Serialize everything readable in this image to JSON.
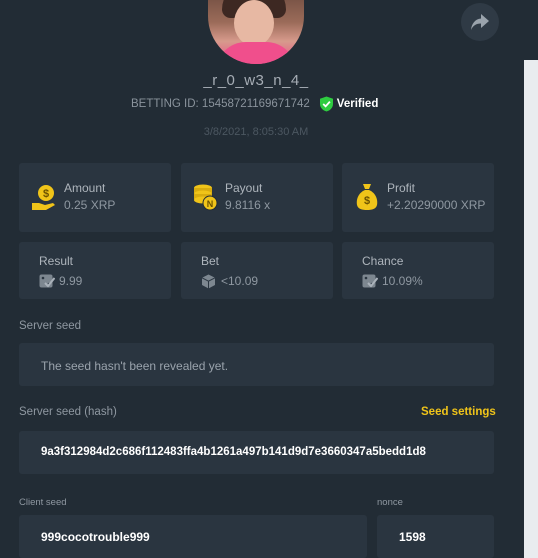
{
  "header": {
    "username": "_r_0_w3_n_4_",
    "betting_id": "BETTING ID: 15458721169671742",
    "verified_label": "Verified",
    "timestamp": "3/8/2021, 8:05:30 AM"
  },
  "stats": {
    "amount": {
      "label": "Amount",
      "value": "0.25 XRP"
    },
    "payout": {
      "label": "Payout",
      "value": "9.8116 x"
    },
    "profit": {
      "label": "Profit",
      "value": "+2.20290000 XRP"
    },
    "result": {
      "label": "Result",
      "value": "9.99"
    },
    "bet": {
      "label": "Bet",
      "value": "<10.09"
    },
    "chance": {
      "label": "Chance",
      "value": "10.09%"
    }
  },
  "server_seed": {
    "label": "Server seed",
    "value": "The seed hasn't been revealed yet."
  },
  "server_seed_hash": {
    "label": "Server seed (hash)",
    "settings_link": "Seed settings",
    "value": "9a3f312984d2c686f112483ffa4b1261a497b141d9d7e3660347a5bedd1d8"
  },
  "client_seed": {
    "label": "Client seed",
    "value": "999cocotrouble999"
  },
  "nonce": {
    "label": "nonce",
    "value": "1598"
  },
  "colors": {
    "accent": "#f0c419",
    "verified": "#2ecc40",
    "background": "#222c35",
    "card": "#2a3540"
  }
}
